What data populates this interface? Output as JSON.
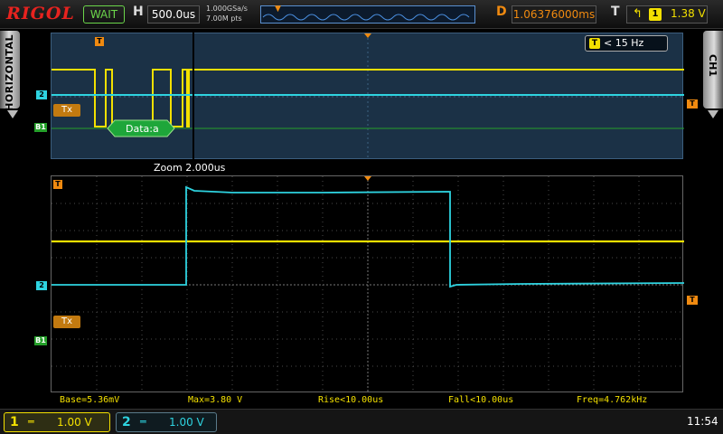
{
  "topbar": {
    "logo": "RIGOL",
    "run_state": "WAIT",
    "h_label": "H",
    "timebase": "500.0us",
    "sample_rate": "1.000GSa/s",
    "memory_depth": "7.00M pts",
    "d_label": "D",
    "trigger_delay": "1.06376000ms",
    "t_label": "T",
    "trigger_edge_icon": "rising-edge-icon",
    "trigger_source": "1",
    "trigger_level": "1.38 V"
  },
  "side": {
    "left_tab": "HORIZONTAL",
    "right_tab": "CH1"
  },
  "overview": {
    "trigger_freq": "< 15 Hz",
    "trigger_freq_icon": "T",
    "tx_label": "Tx",
    "decode_label": "Data:a",
    "ch2_marker": "2",
    "bus_marker": "B1",
    "trigger_marker": "T"
  },
  "zoom": {
    "label": "Zoom  2.000us"
  },
  "main": {
    "tx_label": "Tx",
    "ch2_marker": "2",
    "bus_marker": "B1",
    "trigger_marker": "T"
  },
  "measurements": {
    "base": "Base=5.36mV",
    "max": "Max=3.80 V",
    "rise": "Rise<10.00us",
    "fall": "Fall<10.00us",
    "freq": "Freq=4.762kHz"
  },
  "channels": {
    "ch1": {
      "num": "1",
      "coupling": "═",
      "scale": "1.00 V",
      "color": "#f3e000"
    },
    "ch2": {
      "num": "2",
      "coupling": "═",
      "scale": "1.00 V",
      "color": "#2ed3e0"
    }
  },
  "clock": "11:54"
}
